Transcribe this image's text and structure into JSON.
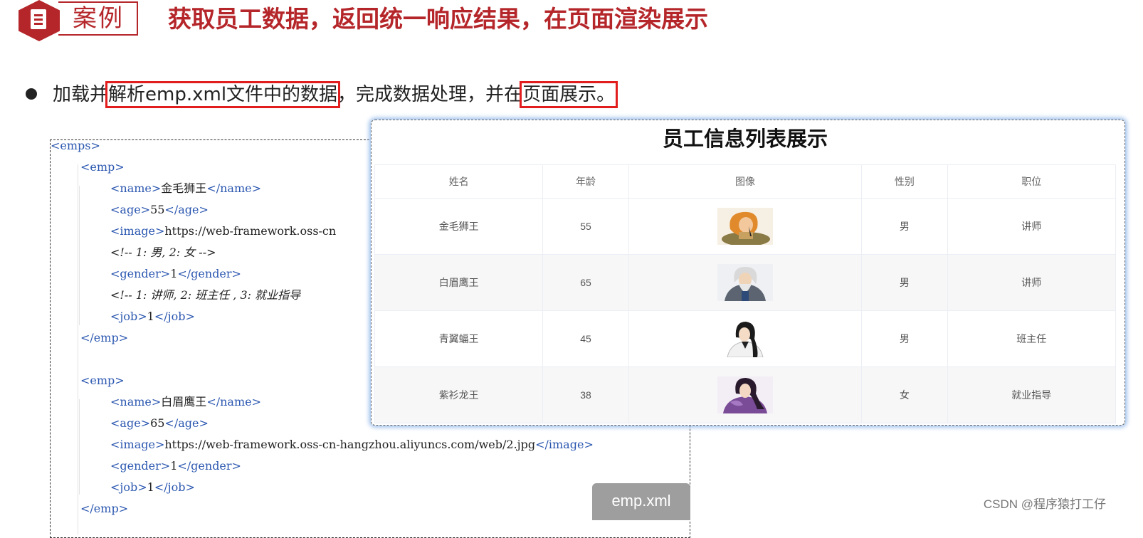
{
  "header": {
    "badge_label": "案例",
    "title": "获取员工数据，返回统一响应结果，在页面渲染展示"
  },
  "bullet": {
    "prefix": "加载并",
    "highlight1": "解析emp.xml文件中的数据",
    "middle": "，完成数据处理，并在",
    "highlight2": "页面展示。"
  },
  "code": {
    "file_tab": "emp.xml",
    "emps_open": "emps",
    "emp_tag": "emp",
    "name_tag": "name",
    "age_tag": "age",
    "image_tag": "image",
    "gender_tag": "gender",
    "job_tag": "job",
    "emp1": {
      "name": "金毛狮王",
      "age": "55",
      "image_partial": "https://web-framework.oss-cn",
      "gender_comment": "<!-- 1: 男, 2: 女 -->",
      "gender": "1",
      "job_comment": "<!-- 1: 讲师, 2: 班主任 , 3: 就业指导",
      "job": "1"
    },
    "emp2": {
      "name": "白眉鹰王",
      "age": "65",
      "image": "https://web-framework.oss-cn-hangzhou.aliyuncs.com/web/2.jpg",
      "gender": "1",
      "job": "1"
    }
  },
  "table": {
    "title": "员工信息列表展示",
    "headers": [
      "姓名",
      "年龄",
      "图像",
      "性别",
      "职位"
    ],
    "rows": [
      {
        "name": "金毛狮王",
        "age": "55",
        "avatar": "avatar-1",
        "gender": "男",
        "job": "讲师"
      },
      {
        "name": "白眉鹰王",
        "age": "65",
        "avatar": "avatar-2",
        "gender": "男",
        "job": "讲师"
      },
      {
        "name": "青翼蝠王",
        "age": "45",
        "avatar": "avatar-3",
        "gender": "男",
        "job": "班主任"
      },
      {
        "name": "紫衫龙王",
        "age": "38",
        "avatar": "avatar-4",
        "gender": "女",
        "job": "就业指导"
      }
    ]
  },
  "watermark": "CSDN @程序猿打工仔",
  "colors": {
    "accent": "#b5262a",
    "highlight_border": "#e21d1d",
    "xml_tag": "#2b57b0",
    "comment": "#8a8a8a",
    "panel_glow": "#8fb6e8"
  }
}
